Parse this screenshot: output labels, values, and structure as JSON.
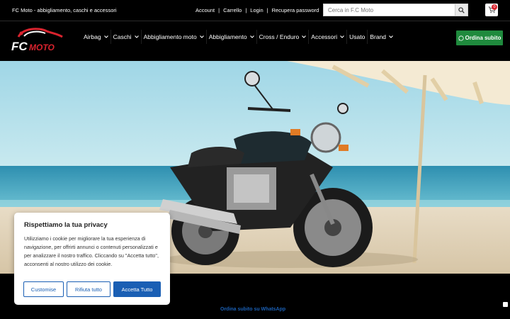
{
  "topbar": {
    "tagline": "FC Moto - abbigliamento, caschi e accessori",
    "links": [
      "Account",
      "Carrello",
      "Login",
      "Recupera password"
    ],
    "search_placeholder": "Cerca in F.C Moto",
    "cart_count": "0"
  },
  "logo": {
    "text_fc": "FC",
    "text_moto": "MOTO"
  },
  "nav": {
    "items": [
      {
        "label": "Airbag",
        "dropdown": true
      },
      {
        "label": "Caschi",
        "dropdown": true
      },
      {
        "label": "Abbigliamento moto",
        "dropdown": true
      },
      {
        "label": "Abbigliamento",
        "dropdown": true
      },
      {
        "label": "Cross / Enduro",
        "dropdown": true
      },
      {
        "label": "Accessori",
        "dropdown": true
      },
      {
        "label": "Usato",
        "dropdown": false
      },
      {
        "label": "Brand",
        "dropdown": true
      }
    ],
    "order_button": "Ordina subito"
  },
  "cookie": {
    "title": "Rispettiamo la tua privacy",
    "text": "Utilizziamo i cookie per migliorare la tua esperienza di navigazione, per offrirti annunci o contenuti personalizzati e per analizzare il nostro traffico. Cliccando su \"Accetta tutto\", acconsenti al nostro utilizzo dei cookie.",
    "customize": "Customise",
    "reject": "Rifiuta tutto",
    "accept": "Accetta Tutto"
  },
  "footer": {
    "whatsapp_link": "Ordina subito su WhatsApp"
  },
  "colors": {
    "accent_blue": "#1a5fb4",
    "whatsapp_green": "#1f8a3d",
    "brand_red": "#d9232e"
  }
}
